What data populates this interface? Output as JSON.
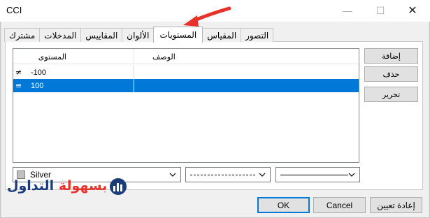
{
  "window": {
    "title": "CCI"
  },
  "tabs": [
    {
      "label": "مشترك",
      "active": false
    },
    {
      "label": "المدخلات",
      "active": false
    },
    {
      "label": "المقاييس",
      "active": false
    },
    {
      "label": "الألوان",
      "active": false
    },
    {
      "label": "المستويات",
      "active": true
    },
    {
      "label": "المقياس",
      "active": false
    },
    {
      "label": "التصور",
      "active": false
    }
  ],
  "levels": {
    "columns": [
      "المستوى",
      "الوصف"
    ],
    "rows": [
      {
        "level": "-100",
        "description": "",
        "selected": false
      },
      {
        "level": "100",
        "description": "",
        "selected": true
      }
    ]
  },
  "side_buttons": {
    "add": "إضافة",
    "delete": "حذف",
    "edit": "تحرير"
  },
  "style": {
    "color_value": "Silver",
    "color_hex": "#c0c0c0",
    "line_style": "dashed",
    "line_width": "solid"
  },
  "bottom_buttons": {
    "ok": "OK",
    "cancel": "Cancel",
    "reset": "إعادة تعيين"
  },
  "watermark": {
    "word1": "التداول",
    "word2": "بسهولة"
  },
  "colors": {
    "selection": "#0078d7",
    "arrow": "#e8312b"
  }
}
